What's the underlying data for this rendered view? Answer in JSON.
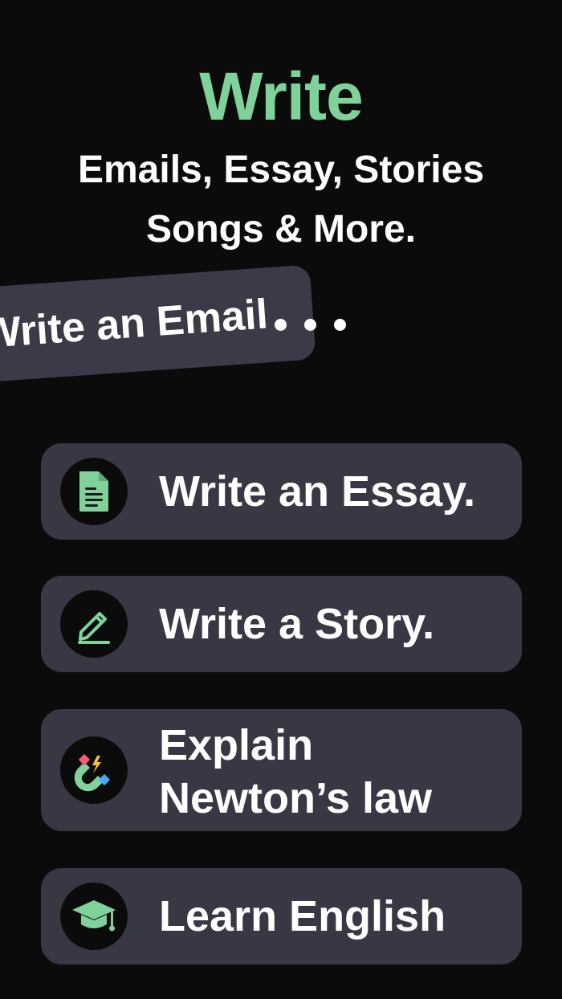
{
  "header": {
    "title": "Write",
    "subtitle_line1": "Emails, Essay, Stories",
    "subtitle_line2": "Songs & More."
  },
  "typing_banner": {
    "text": "Write an Email"
  },
  "cards": [
    {
      "label": "Write an Essay.",
      "icon": "document-icon"
    },
    {
      "label": "Write a Story.",
      "icon": "pencil-icon"
    },
    {
      "label_line1": "Explain",
      "label_line2": "Newton’s law",
      "icon": "magnet-icon"
    },
    {
      "label": "Learn English",
      "icon": "graduation-cap-icon"
    }
  ],
  "colors": {
    "background": "#0b0b0b",
    "accent_green": "#7fd39a",
    "card": "#383845",
    "banner": "#3b3b47"
  }
}
